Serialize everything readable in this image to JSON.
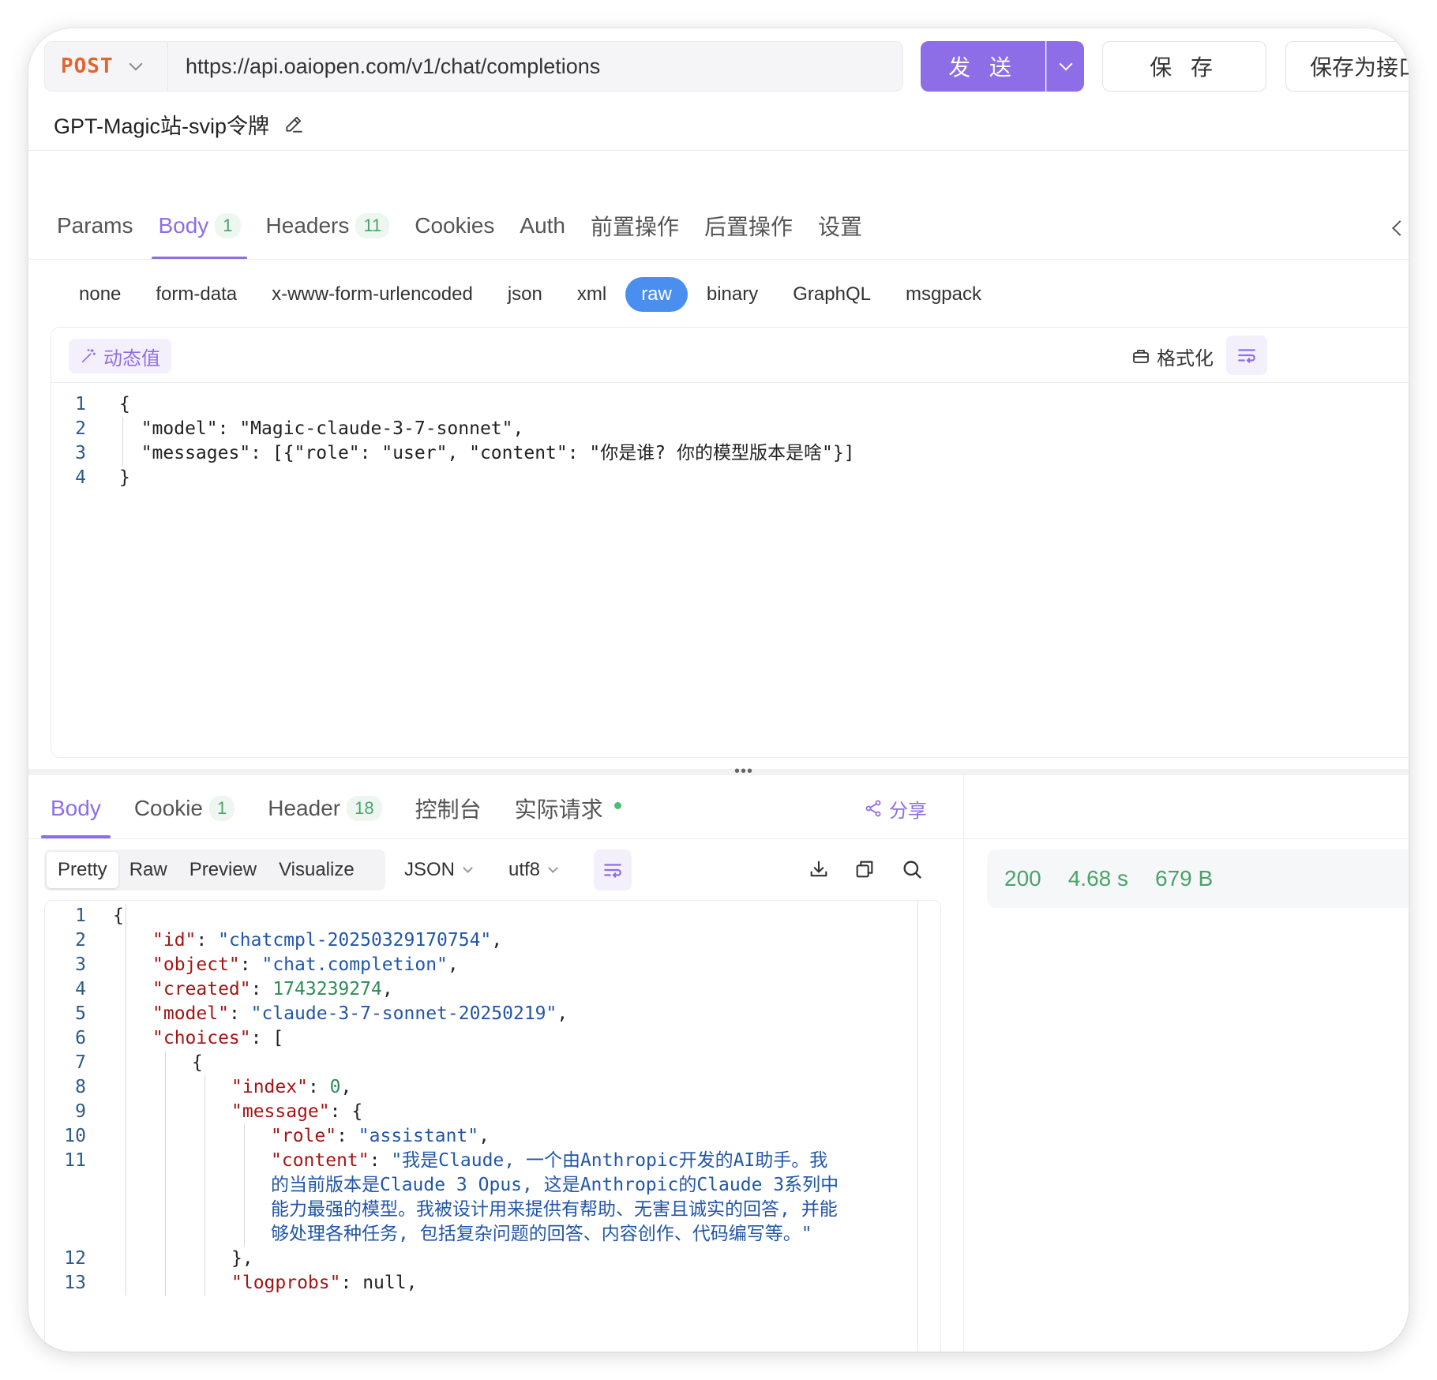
{
  "request": {
    "method": "POST",
    "url": "https://api.oaiopen.com/v1/chat/completions",
    "send_label": "发 送",
    "save_label": "保 存",
    "save_as_label": "保存为接口",
    "name": "GPT-Magic站-svip令牌"
  },
  "request_tabs": [
    {
      "label": "Params",
      "count": ""
    },
    {
      "label": "Body",
      "count": "1"
    },
    {
      "label": "Headers",
      "count": "11"
    },
    {
      "label": "Cookies",
      "count": ""
    },
    {
      "label": "Auth",
      "count": ""
    },
    {
      "label": "前置操作",
      "count": ""
    },
    {
      "label": "后置操作",
      "count": ""
    },
    {
      "label": "设置",
      "count": ""
    }
  ],
  "body_types": [
    "none",
    "form-data",
    "x-www-form-urlencoded",
    "json",
    "xml",
    "raw",
    "binary",
    "GraphQL",
    "msgpack"
  ],
  "editor": {
    "dynamic_label": "动态值",
    "format_label": "格式化",
    "lines": [
      "{",
      "  \"model\": \"Magic-claude-3-7-sonnet\",",
      "  \"messages\": [{\"role\": \"user\", \"content\": \"你是谁? 你的模型版本是啥\"}]",
      "}"
    ]
  },
  "response_tabs": [
    {
      "label": "Body",
      "count": ""
    },
    {
      "label": "Cookie",
      "count": "1"
    },
    {
      "label": "Header",
      "count": "18"
    },
    {
      "label": "控制台",
      "count": ""
    },
    {
      "label": "实际请求",
      "count": ""
    }
  ],
  "share_label": "分享",
  "view_modes": [
    "Pretty",
    "Raw",
    "Preview",
    "Visualize"
  ],
  "format_select": "JSON",
  "encoding_select": "utf8",
  "response_lines": [
    {
      "n": "1",
      "indent": 0,
      "parts": [
        [
          "p",
          "{"
        ]
      ]
    },
    {
      "n": "2",
      "indent": 1,
      "parts": [
        [
          "k",
          "\"id\""
        ],
        [
          "p",
          ": "
        ],
        [
          "s",
          "\"chatcmpl-20250329170754\""
        ],
        [
          "p",
          ","
        ]
      ]
    },
    {
      "n": "3",
      "indent": 1,
      "parts": [
        [
          "k",
          "\"object\""
        ],
        [
          "p",
          ": "
        ],
        [
          "s",
          "\"chat.completion\""
        ],
        [
          "p",
          ","
        ]
      ]
    },
    {
      "n": "4",
      "indent": 1,
      "parts": [
        [
          "k",
          "\"created\""
        ],
        [
          "p",
          ": "
        ],
        [
          "n",
          "1743239274"
        ],
        [
          "p",
          ","
        ]
      ]
    },
    {
      "n": "5",
      "indent": 1,
      "parts": [
        [
          "k",
          "\"model\""
        ],
        [
          "p",
          ": "
        ],
        [
          "s",
          "\"claude-3-7-sonnet-20250219\""
        ],
        [
          "p",
          ","
        ]
      ]
    },
    {
      "n": "6",
      "indent": 1,
      "parts": [
        [
          "k",
          "\"choices\""
        ],
        [
          "p",
          ": ["
        ]
      ]
    },
    {
      "n": "7",
      "indent": 2,
      "parts": [
        [
          "p",
          "{"
        ]
      ]
    },
    {
      "n": "8",
      "indent": 3,
      "parts": [
        [
          "k",
          "\"index\""
        ],
        [
          "p",
          ": "
        ],
        [
          "n",
          "0"
        ],
        [
          "p",
          ","
        ]
      ]
    },
    {
      "n": "9",
      "indent": 3,
      "parts": [
        [
          "k",
          "\"message\""
        ],
        [
          "p",
          ": {"
        ]
      ]
    },
    {
      "n": "10",
      "indent": 4,
      "parts": [
        [
          "k",
          "\"role\""
        ],
        [
          "p",
          ": "
        ],
        [
          "s",
          "\"assistant\""
        ],
        [
          "p",
          ","
        ]
      ]
    },
    {
      "n": "11",
      "indent": 4,
      "parts": [
        [
          "k",
          "\"content\""
        ],
        [
          "p",
          ": "
        ],
        [
          "s",
          "\"我是Claude, 一个由Anthropic开发的AI助手。我"
        ]
      ]
    },
    {
      "n": "",
      "indent": 4,
      "parts": [
        [
          "s",
          "的当前版本是Claude 3 Opus, 这是Anthropic的Claude 3系列中"
        ]
      ]
    },
    {
      "n": "",
      "indent": 4,
      "parts": [
        [
          "s",
          "能力最强的模型。我被设计用来提供有帮助、无害且诚实的回答, 并能"
        ]
      ]
    },
    {
      "n": "",
      "indent": 4,
      "parts": [
        [
          "s",
          "够处理各种任务, 包括复杂问题的回答、内容创作、代码编写等。\""
        ]
      ]
    },
    {
      "n": "12",
      "indent": 3,
      "parts": [
        [
          "p",
          "},"
        ]
      ]
    },
    {
      "n": "13",
      "indent": 3,
      "parts": [
        [
          "k",
          "\"logprobs\""
        ],
        [
          "p",
          ": "
        ],
        [
          "p",
          "null,"
        ]
      ]
    }
  ],
  "stats": {
    "status": "200",
    "time": "4.68 s",
    "size": "679 B"
  },
  "colors": {
    "accent": "#8e6ee6",
    "method": "#e0662e",
    "raw_pill": "#4a8ff0",
    "success": "#4aa36a"
  }
}
